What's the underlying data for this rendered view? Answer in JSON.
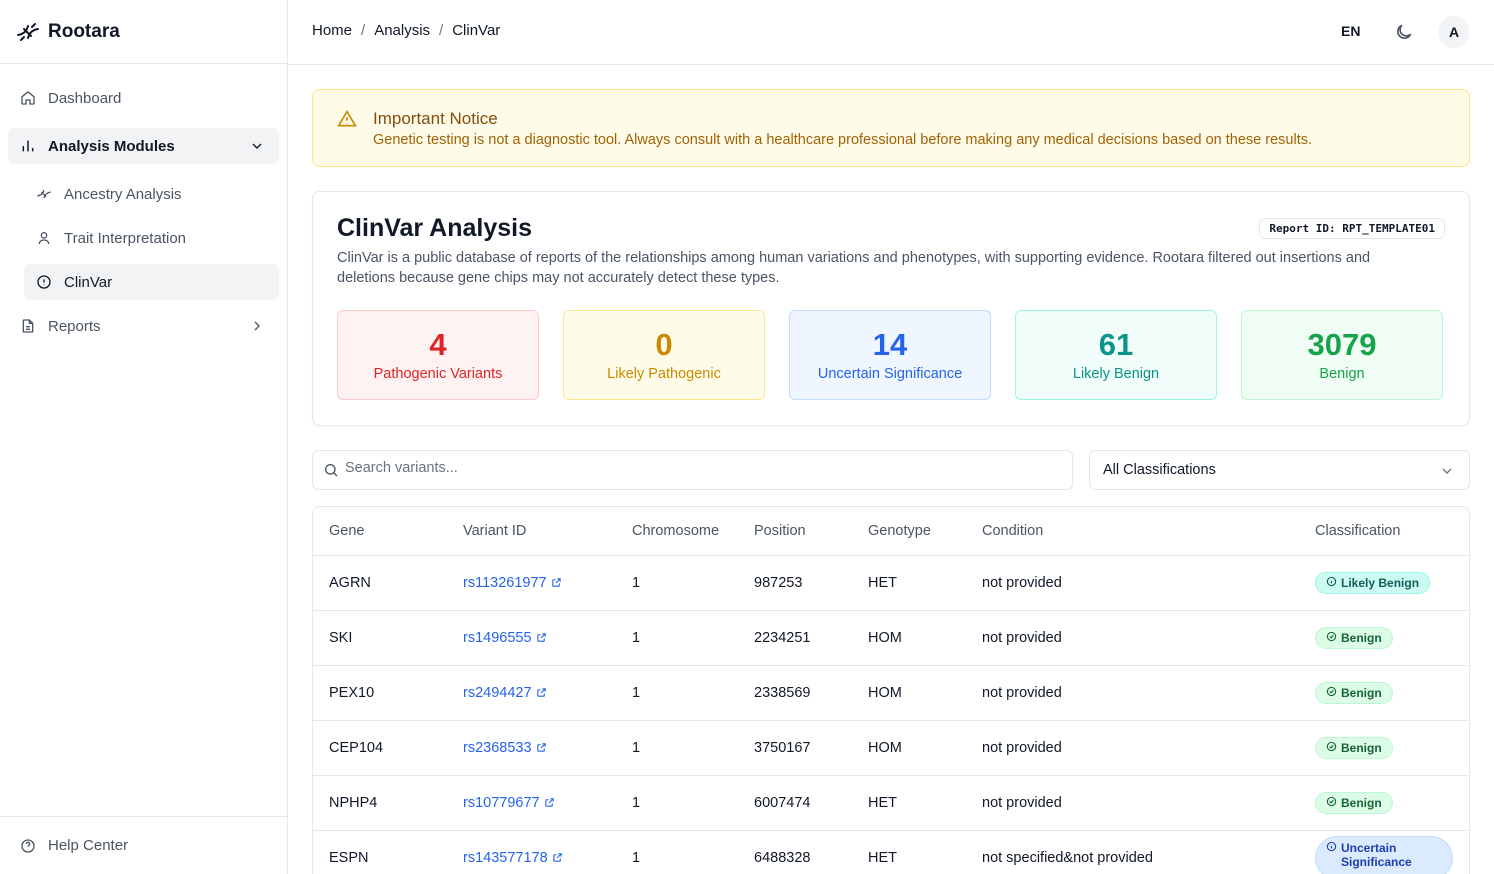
{
  "app": {
    "name": "Rootara"
  },
  "header": {
    "breadcrumb": [
      "Home",
      "Analysis",
      "ClinVar"
    ],
    "breadcrumb_sep": "/",
    "language": "EN",
    "avatar_initial": "A"
  },
  "sidebar": {
    "dashboard": "Dashboard",
    "analysis_modules": "Analysis Modules",
    "ancestry": "Ancestry Analysis",
    "trait": "Trait Interpretation",
    "clinvar": "ClinVar",
    "reports": "Reports",
    "help": "Help Center"
  },
  "notice": {
    "title": "Important Notice",
    "message": "Genetic testing is not a diagnostic tool. Always consult with a healthcare professional before making any medical decisions based on these results."
  },
  "card": {
    "title": "ClinVar Analysis",
    "report_id": "Report ID: RPT_TEMPLATE01",
    "description": "ClinVar is a public database of reports of the relationships among human variations and phenotypes, with supporting evidence. Rootara filtered out insertions and deletions because gene chips may not accurately detect these types.",
    "stats": [
      {
        "value": "4",
        "label": "Pathogenic Variants",
        "color": "#dc2626"
      },
      {
        "value": "0",
        "label": "Likely Pathogenic",
        "color": "#ca8a04"
      },
      {
        "value": "14",
        "label": "Uncertain Significance",
        "color": "#2563eb"
      },
      {
        "value": "61",
        "label": "Likely Benign",
        "color": "#0d9488"
      },
      {
        "value": "3079",
        "label": "Benign",
        "color": "#16a34a"
      }
    ]
  },
  "filters": {
    "search_placeholder": "Search variants...",
    "classification_selected": "All Classifications"
  },
  "table": {
    "columns": [
      "Gene",
      "Variant ID",
      "Chromosome",
      "Position",
      "Genotype",
      "Condition",
      "Classification"
    ],
    "rows": [
      {
        "gene": "AGRN",
        "variant": "rs113261977",
        "chromosome": "1",
        "position": "987253",
        "genotype": "HET",
        "condition": "not provided",
        "classification": "Likely Benign"
      },
      {
        "gene": "SKI",
        "variant": "rs1496555",
        "chromosome": "1",
        "position": "2234251",
        "genotype": "HOM",
        "condition": "not provided",
        "classification": "Benign"
      },
      {
        "gene": "PEX10",
        "variant": "rs2494427",
        "chromosome": "1",
        "position": "2338569",
        "genotype": "HOM",
        "condition": "not provided",
        "classification": "Benign"
      },
      {
        "gene": "CEP104",
        "variant": "rs2368533",
        "chromosome": "1",
        "position": "3750167",
        "genotype": "HOM",
        "condition": "not provided",
        "classification": "Benign"
      },
      {
        "gene": "NPHP4",
        "variant": "rs10779677",
        "chromosome": "1",
        "position": "6007474",
        "genotype": "HET",
        "condition": "not provided",
        "classification": "Benign"
      },
      {
        "gene": "ESPN",
        "variant": "rs143577178",
        "chromosome": "1",
        "position": "6488328",
        "genotype": "HET",
        "condition": "not specified&not provided",
        "classification": "Uncertain Significance"
      }
    ]
  }
}
